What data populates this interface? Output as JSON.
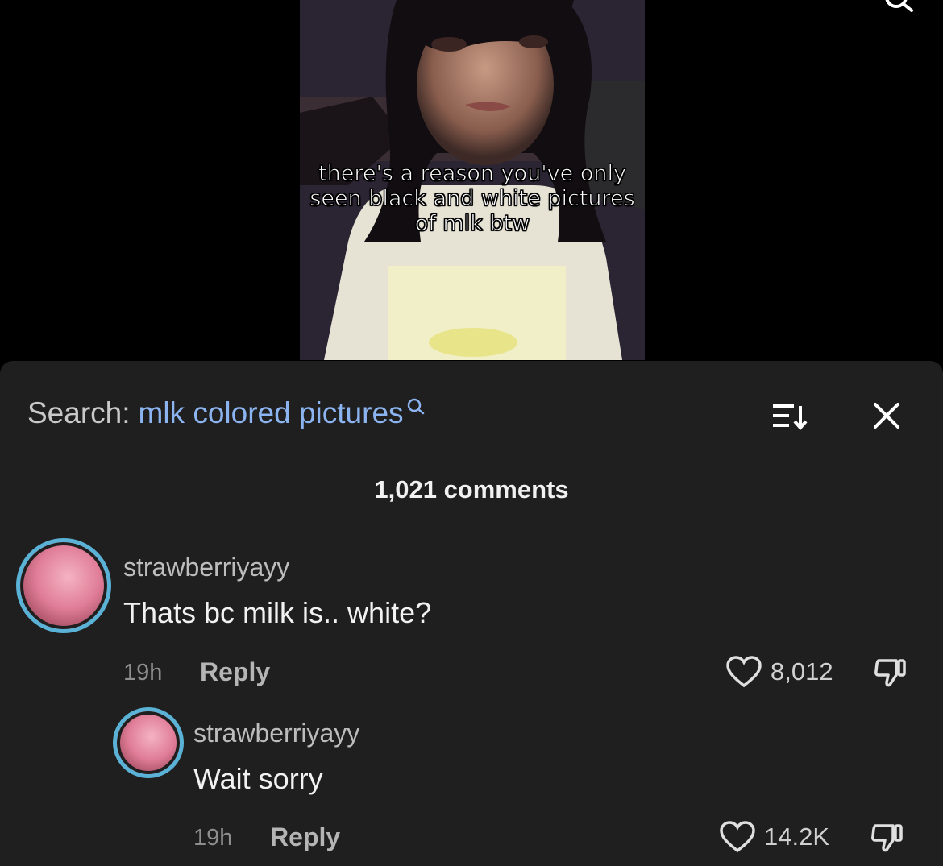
{
  "video": {
    "caption": "there's a reason you've only seen black and white pictures of mlk btw"
  },
  "search": {
    "label": "Search:",
    "query": "mlk colored pictures"
  },
  "comments_header": {
    "count_text": "1,021 comments"
  },
  "comments": [
    {
      "username": "strawberriyayy",
      "text": "Thats bc milk is.. white?",
      "time": "19h",
      "reply_label": "Reply",
      "likes": "8,012"
    },
    {
      "username": "strawberriyayy",
      "text": "Wait sorry",
      "time": "19h",
      "reply_label": "Reply",
      "likes": "14.2K"
    }
  ],
  "icons": {
    "top_search": "search-icon",
    "inline_search": "search-icon",
    "sort": "sort-icon",
    "close": "close-icon",
    "like": "heart-icon",
    "dislike": "thumbs-down-icon"
  },
  "colors": {
    "sheet_background": "#1f1f1f",
    "search_query": "#8cb4f0",
    "avatar_ring": "#5ab3d6"
  }
}
